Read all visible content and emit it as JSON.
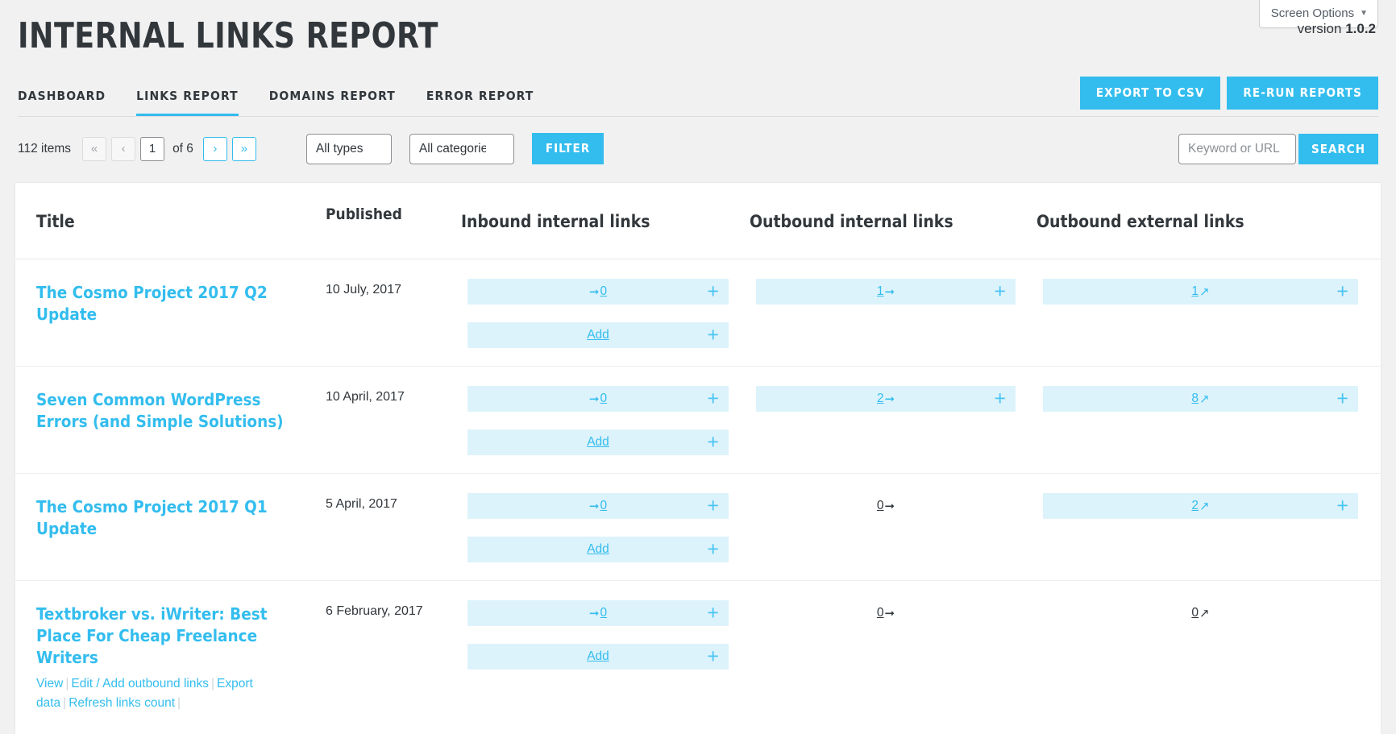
{
  "screen_options": {
    "label": "Screen Options",
    "caret": "▼"
  },
  "header": {
    "title": "INTERNAL LINKS REPORT",
    "version_label": "version",
    "version_number": "1.0.2",
    "tabs": [
      {
        "label": "DASHBOARD",
        "active": false
      },
      {
        "label": "LINKS REPORT",
        "active": true
      },
      {
        "label": "DOMAINS REPORT",
        "active": false
      },
      {
        "label": "ERROR REPORT",
        "active": false
      }
    ],
    "buttons": [
      {
        "label": "EXPORT TO CSV"
      },
      {
        "label": "RE-RUN REPORTS"
      }
    ]
  },
  "toolbar": {
    "items_count": "112 items",
    "pager": {
      "first": "«",
      "prev": "‹",
      "current_page": "1",
      "of_label": "of 6",
      "next": "›",
      "last": "»"
    },
    "type_filter": {
      "selected": "All types",
      "caret": "⌄"
    },
    "category_filter": {
      "selected": "All categories",
      "caret": "⌄"
    },
    "filter_button": "FILTER",
    "search": {
      "placeholder": "Keyword or URL",
      "value": "",
      "button": "SEARCH"
    }
  },
  "table": {
    "columns": [
      "Title",
      "Published",
      "Inbound internal links",
      "Outbound internal links",
      "Outbound external links"
    ],
    "add_label": "Add",
    "plus_glyph": "+",
    "arrow_in": "➞",
    "arrow_out": "➞",
    "arrow_ext": "↗",
    "rows": [
      {
        "title": "The Cosmo Project 2017 Q2 Update",
        "published": "10 July, 2017",
        "actions": [],
        "inbound": {
          "count": "0",
          "has_pill": true,
          "has_plus": true,
          "has_add": true
        },
        "outbound_internal": {
          "count": "1",
          "has_pill": true,
          "has_plus": true
        },
        "outbound_external": {
          "count": "1",
          "has_pill": true,
          "has_plus": true
        }
      },
      {
        "title": "Seven Common WordPress Errors (and Simple Solutions)",
        "published": "10 April, 2017",
        "actions": [],
        "inbound": {
          "count": "0",
          "has_pill": true,
          "has_plus": true,
          "has_add": true
        },
        "outbound_internal": {
          "count": "2",
          "has_pill": true,
          "has_plus": true
        },
        "outbound_external": {
          "count": "8",
          "has_pill": true,
          "has_plus": true
        }
      },
      {
        "title": "The Cosmo Project 2017 Q1 Update",
        "published": "5 April, 2017",
        "actions": [],
        "inbound": {
          "count": "0",
          "has_pill": true,
          "has_plus": true,
          "has_add": true
        },
        "outbound_internal": {
          "count": "0",
          "has_pill": false,
          "has_plus": false
        },
        "outbound_external": {
          "count": "2",
          "has_pill": true,
          "has_plus": true
        }
      },
      {
        "title": "Textbroker vs. iWriter: Best Place For Cheap Freelance Writers",
        "published": "6 February, 2017",
        "actions": [
          "View",
          "Edit / Add outbound links",
          "Export data",
          "Refresh links count"
        ],
        "inbound": {
          "count": "0",
          "has_pill": true,
          "has_plus": true,
          "has_add": true
        },
        "outbound_internal": {
          "count": "0",
          "has_pill": false,
          "has_plus": false
        },
        "outbound_external": {
          "count": "0",
          "has_pill": false,
          "has_plus": false
        }
      }
    ]
  },
  "colors": {
    "accent": "#33bdee",
    "pill_bg": "#ddf3fc",
    "page_bg": "#f1f1f1",
    "text": "#32373c"
  }
}
